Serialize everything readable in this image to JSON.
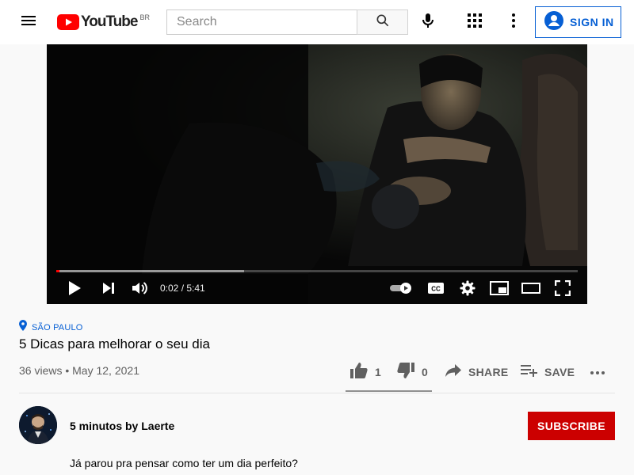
{
  "header": {
    "logo_text": "YouTube",
    "country_code": "BR",
    "search_placeholder": "Search",
    "signin_label": "SIGN IN"
  },
  "player": {
    "time_display": "0:02 / 5:41",
    "played_fraction": 0.006,
    "loaded_fraction": 0.36
  },
  "video": {
    "location": "SÃO PAULO",
    "title": "5 Dicas para melhorar o seu dia",
    "meta": "36 views • May 12, 2021",
    "like_count": "1",
    "dislike_count": "0",
    "share_label": "SHARE",
    "save_label": "SAVE"
  },
  "channel": {
    "name": "5 minutos by Laerte",
    "subscribe_label": "SUBSCRIBE"
  },
  "description": {
    "first_line": "Já parou pra pensar como ter um dia perfeito?"
  },
  "colors": {
    "brand_red": "#ff0000",
    "subscribe_red": "#cc0000",
    "link_blue": "#065fd4"
  }
}
